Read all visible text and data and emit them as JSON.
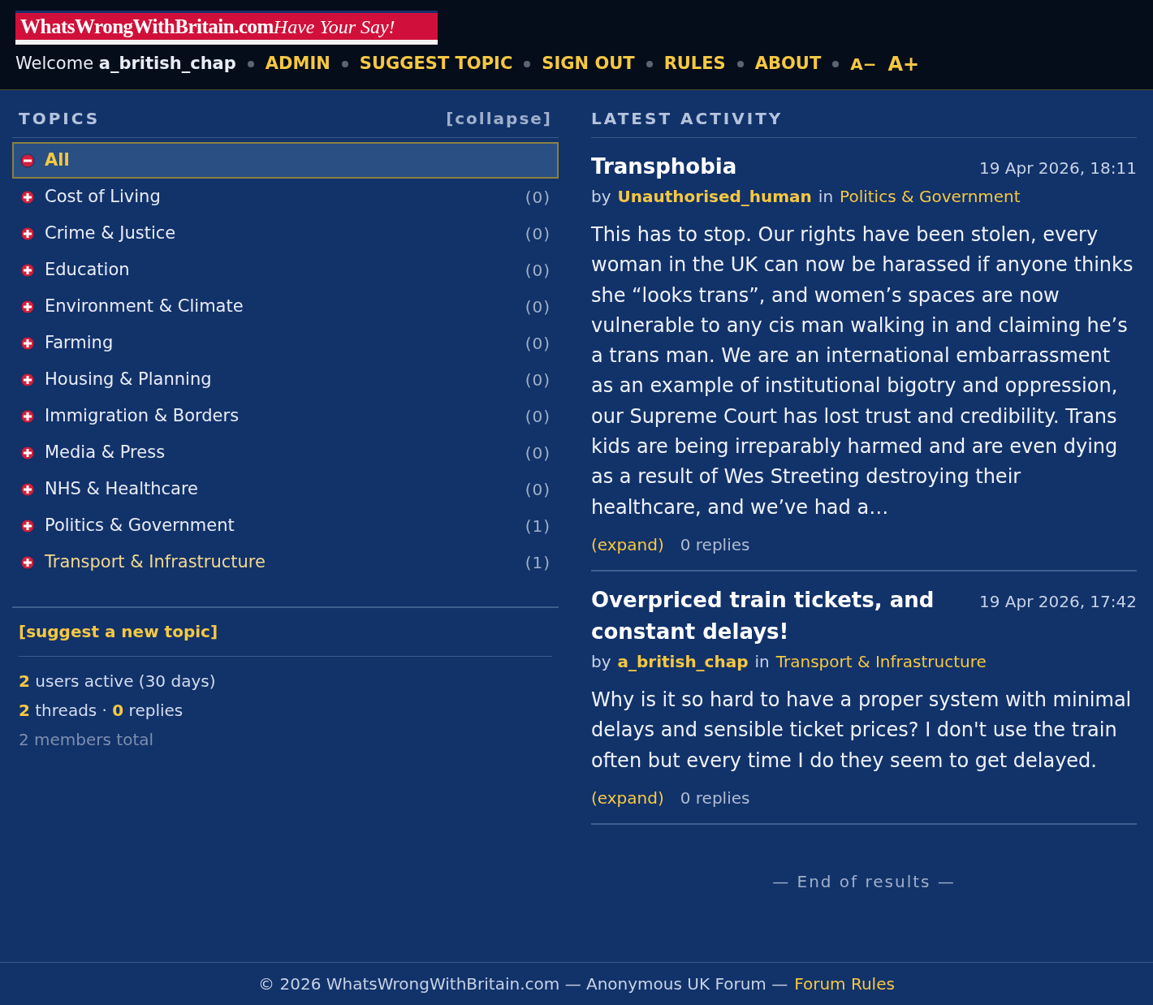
{
  "header": {
    "logo": {
      "site": "WhatsWrongWithBritain.com",
      "tagline": "Have Your Say!"
    },
    "welcome": "Welcome",
    "username": "a_british_chap",
    "nav": [
      "ADMIN",
      "SUGGEST TOPIC",
      "SIGN OUT",
      "RULES",
      "ABOUT"
    ],
    "font_controls": [
      "A−",
      "A+"
    ]
  },
  "sidebar": {
    "title": "TOPICS",
    "collapse": "[collapse]",
    "topics": [
      {
        "name": "All",
        "selected": true,
        "expanded": true,
        "hovered": false
      },
      {
        "name": "Cost of Living",
        "count": "(0)",
        "selected": false,
        "expanded": false,
        "hovered": false
      },
      {
        "name": "Crime & Justice",
        "count": "(0)",
        "selected": false,
        "expanded": false,
        "hovered": false
      },
      {
        "name": "Education",
        "count": "(0)",
        "selected": false,
        "expanded": false,
        "hovered": false
      },
      {
        "name": "Environment & Climate",
        "count": "(0)",
        "selected": false,
        "expanded": false,
        "hovered": false
      },
      {
        "name": "Farming",
        "count": "(0)",
        "selected": false,
        "expanded": false,
        "hovered": false
      },
      {
        "name": "Housing & Planning",
        "count": "(0)",
        "selected": false,
        "expanded": false,
        "hovered": false
      },
      {
        "name": "Immigration & Borders",
        "count": "(0)",
        "selected": false,
        "expanded": false,
        "hovered": false
      },
      {
        "name": "Media & Press",
        "count": "(0)",
        "selected": false,
        "expanded": false,
        "hovered": false
      },
      {
        "name": "NHS & Healthcare",
        "count": "(0)",
        "selected": false,
        "expanded": false,
        "hovered": false
      },
      {
        "name": "Politics & Government",
        "count": "(1)",
        "selected": false,
        "expanded": false,
        "hovered": false
      },
      {
        "name": "Transport & Infrastructure",
        "count": "(1)",
        "selected": false,
        "expanded": false,
        "hovered": true
      }
    ],
    "suggest": "[suggest a new topic]",
    "stats": [
      "**2** users active (30 days)",
      "**2** threads · **0** replies"
    ],
    "members": "2 members total"
  },
  "activity": {
    "title": "LATEST ACTIVITY",
    "posts": [
      {
        "title": "Transphobia",
        "date": "19 Apr 2026, 18:11",
        "by": "by",
        "author": "Unauthorised_human",
        "in": "in",
        "topic": "Politics & Government",
        "body": "This has to stop. Our rights have been stolen, every woman in the UK can now be harassed if anyone thinks she “looks trans”, and women’s spaces are now vulnerable to any cis man walking in and claiming he’s a trans man. We are an international embarrassment as an example of institutional bigotry and oppression, our Supreme Court has lost trust and credibility. Trans kids are being irreparably harmed and are even dying as a result of Wes Streeting destroying their healthcare, and we’ve had a…",
        "expand": "(expand)",
        "replies": "0 replies"
      },
      {
        "title": "Overpriced train tickets, and constant delays!",
        "date": "19 Apr 2026, 17:42",
        "by": "by",
        "author": "a_british_chap",
        "in": "in",
        "topic": "Transport & Infrastructure",
        "body": "Why is it so hard to have a proper system with minimal delays and sensible ticket prices? I don't use the train often but every time I do they seem to get delayed.",
        "expand": "(expand)",
        "replies": "0 replies"
      }
    ],
    "end": "— End of results —"
  },
  "footer": {
    "text": "© 2026 WhatsWrongWithBritain.com — Anonymous UK Forum —",
    "link": "Forum Rules"
  }
}
